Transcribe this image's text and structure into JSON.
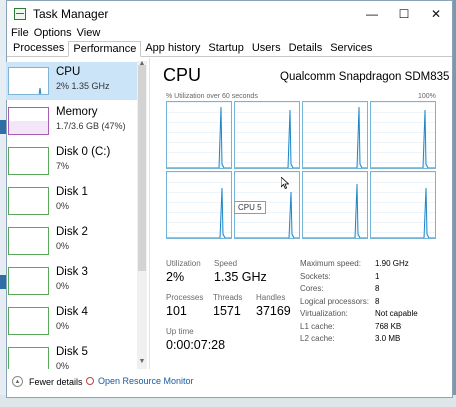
{
  "window": {
    "title": "Task Manager",
    "minimize": "—",
    "maximize": "☐",
    "close": "✕"
  },
  "menu": [
    "File",
    "Options",
    "View"
  ],
  "tabs": [
    "Processes",
    "Performance",
    "App history",
    "Startup",
    "Users",
    "Details",
    "Services"
  ],
  "active_tab": "Performance",
  "resources": [
    {
      "name": "CPU",
      "sub": "2% 1.35 GHz",
      "kind": "cpu",
      "selected": true
    },
    {
      "name": "Memory",
      "sub": "1.7/3.6 GB (47%)",
      "kind": "mem"
    },
    {
      "name": "Disk 0 (C:)",
      "sub": "7%",
      "kind": "disk"
    },
    {
      "name": "Disk 1",
      "sub": "0%",
      "kind": "disk"
    },
    {
      "name": "Disk 2",
      "sub": "0%",
      "kind": "disk"
    },
    {
      "name": "Disk 3",
      "sub": "0%",
      "kind": "disk"
    },
    {
      "name": "Disk 4",
      "sub": "0%",
      "kind": "disk"
    },
    {
      "name": "Disk 5",
      "sub": "0%",
      "kind": "disk"
    }
  ],
  "detail": {
    "title": "CPU",
    "model": "Qualcomm Snapdragon SDM835",
    "graph_caption": "% Utilization over 60 seconds",
    "graph_max": "100%",
    "tooltip": "CPU 5",
    "colors": {
      "graph_border": "#75b6d8",
      "graph_line": "#1c86c7",
      "selected_bg": "#cce4f7"
    }
  },
  "stats": {
    "utilization_label": "Utilization",
    "utilization": "2%",
    "speed_label": "Speed",
    "speed": "1.35 GHz",
    "processes_label": "Processes",
    "processes": "101",
    "threads_label": "Threads",
    "threads": "1571",
    "handles_label": "Handles",
    "handles": "37169",
    "uptime_label": "Up time",
    "uptime": "0:00:07:28"
  },
  "specs": [
    {
      "label": "Maximum speed:",
      "value": "1.90 GHz"
    },
    {
      "label": "Sockets:",
      "value": "1"
    },
    {
      "label": "Cores:",
      "value": "8"
    },
    {
      "label": "Logical processors:",
      "value": "8"
    },
    {
      "label": "Virtualization:",
      "value": "Not capable"
    },
    {
      "label": "L1 cache:",
      "value": "768 KB"
    },
    {
      "label": "L2 cache:",
      "value": "3.0 MB"
    }
  ],
  "footer": {
    "fewer_details": "Fewer details",
    "open_monitor": "Open Resource Monitor"
  }
}
